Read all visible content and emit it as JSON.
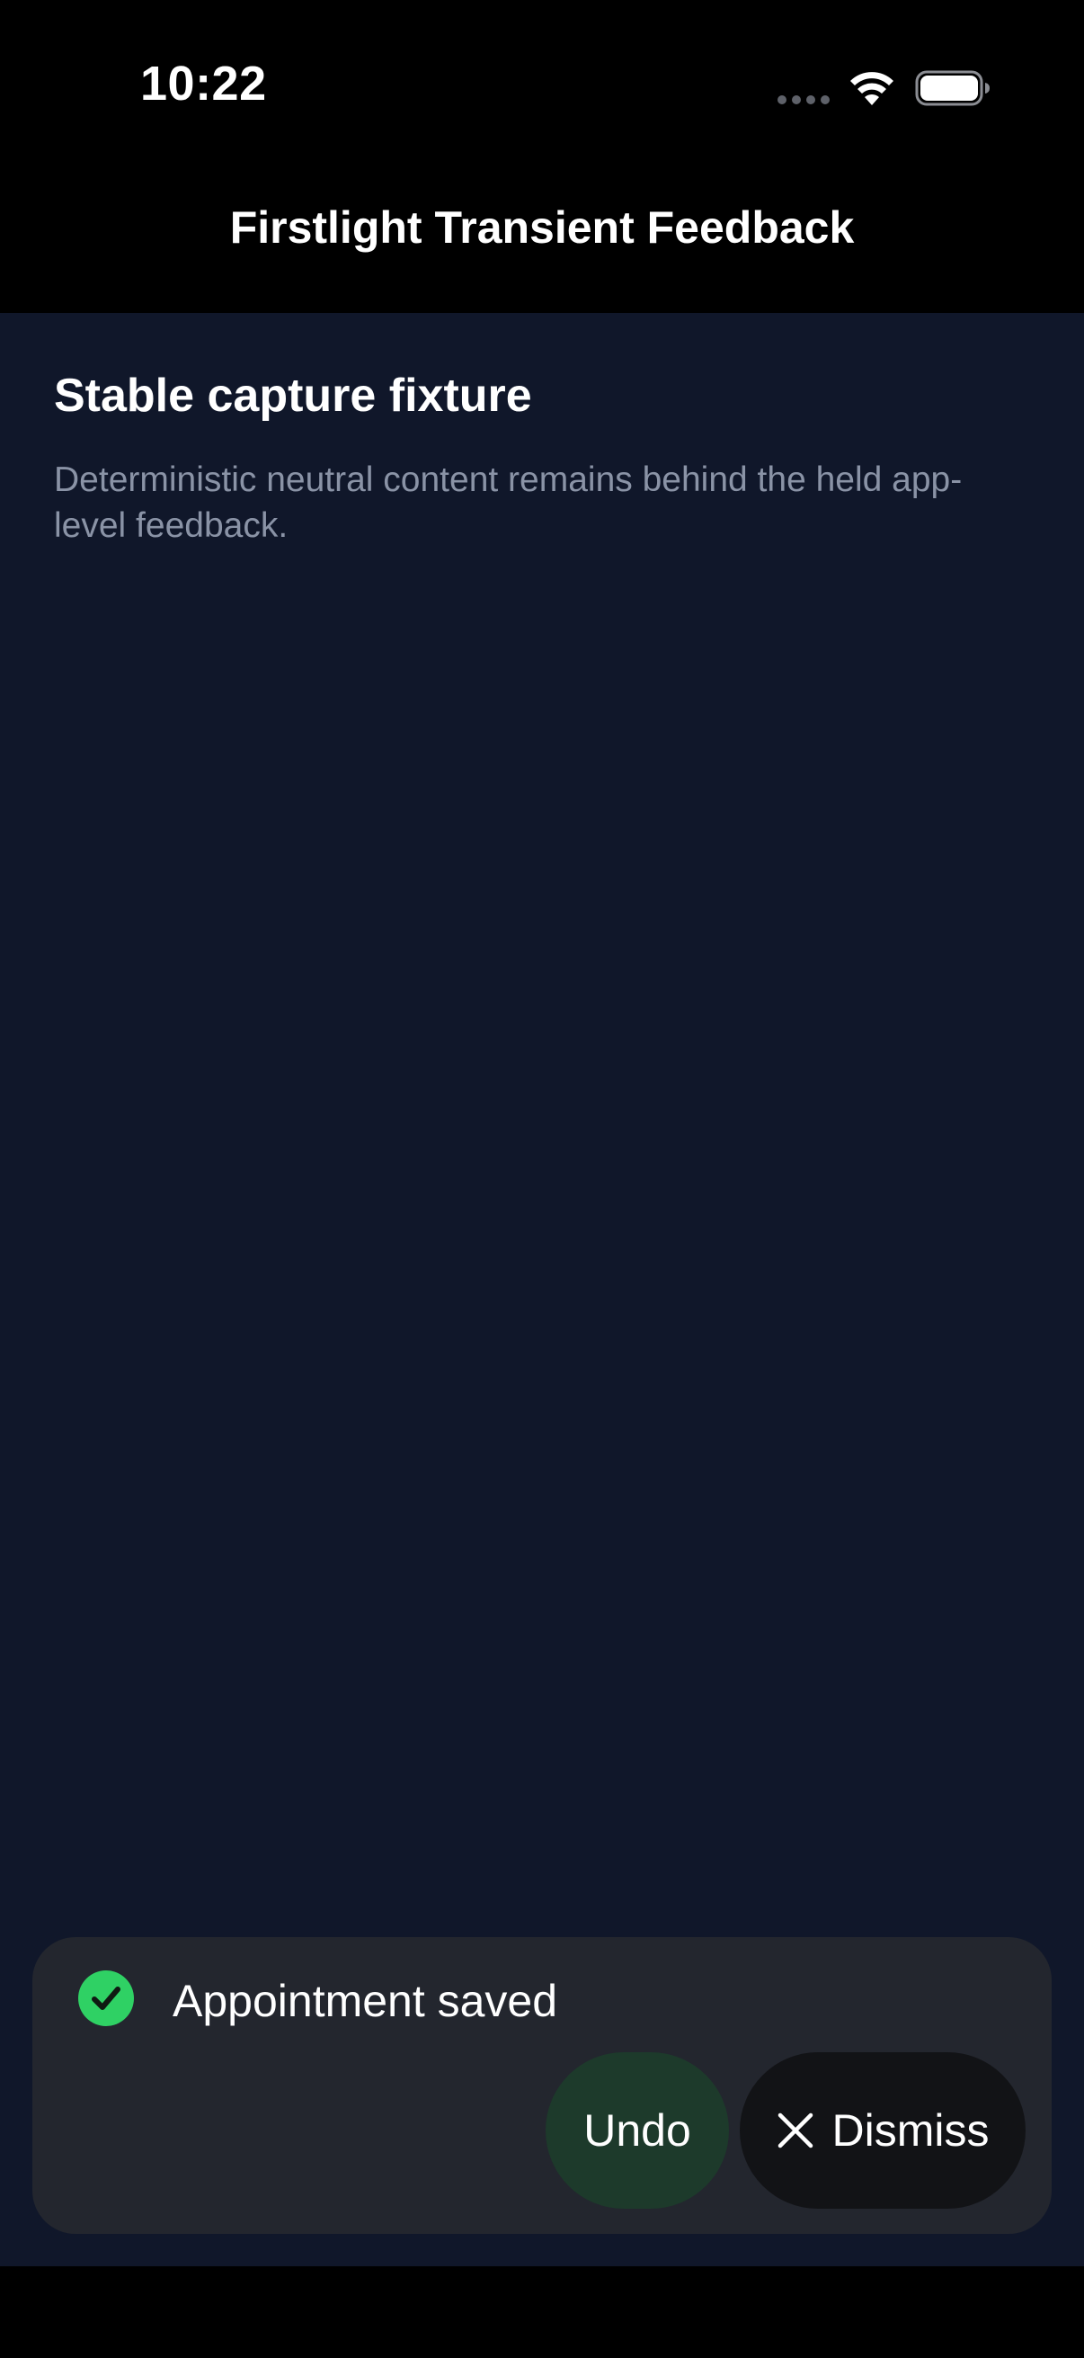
{
  "status_bar": {
    "time": "10:22"
  },
  "header": {
    "title": "Firstlight Transient Feedback"
  },
  "content": {
    "title": "Stable capture fixture",
    "body": "Deterministic neutral content remains behind the held app-level feedback."
  },
  "toast": {
    "message": "Appointment saved",
    "status_icon": "check-circle-icon",
    "undo_label": "Undo",
    "dismiss_label": "Dismiss",
    "dismiss_icon": "close-icon"
  },
  "colors": {
    "content_background": "#10172a",
    "toast_background": "#23262e",
    "success_green": "#2fd164",
    "undo_background": "#1d3a2b",
    "dismiss_background": "#121316"
  }
}
